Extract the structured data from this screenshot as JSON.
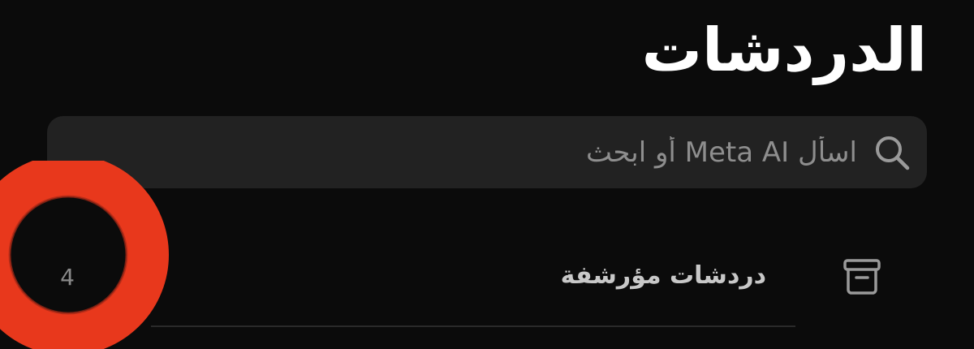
{
  "header": {
    "title": "الدردشات"
  },
  "search": {
    "placeholder": "اسأل Meta AI أو ابحث",
    "value": "",
    "icon": "search-icon"
  },
  "archived": {
    "label": "دردشات مؤرشفة",
    "count": "4",
    "icon": "archive-icon"
  },
  "annotation": {
    "ring_color": "#e8381c",
    "shape": "circle"
  },
  "colors": {
    "background": "#0b0b0b",
    "search_bg": "#222222",
    "title": "#ffffff",
    "muted_text": "#8e8e8e"
  }
}
